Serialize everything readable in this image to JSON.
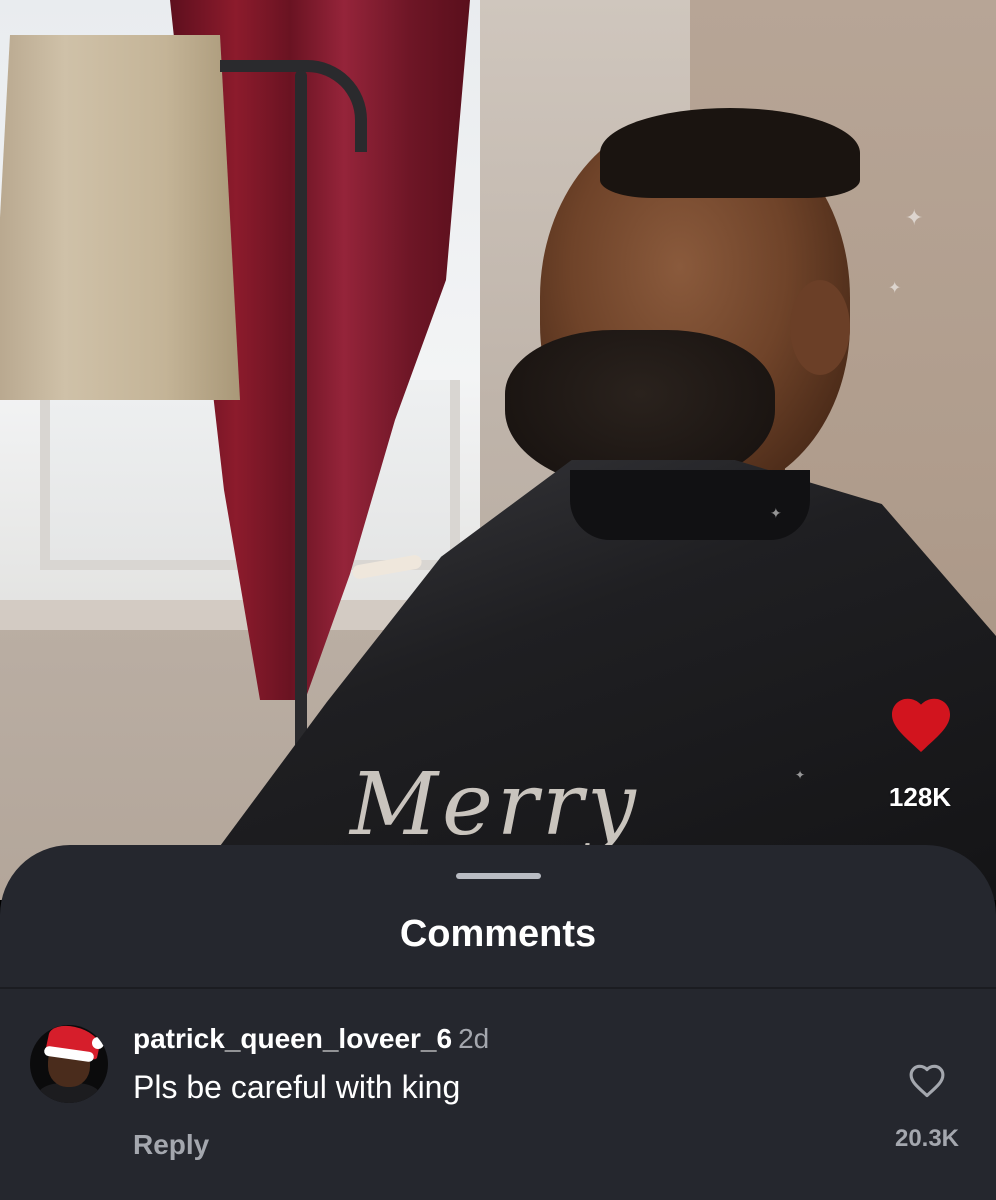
{
  "video": {
    "like_icon": "heart-filled-icon",
    "like_count": "128K",
    "like_color": "#d2141e",
    "cape_text": "Merry"
  },
  "comments_sheet": {
    "title": "Comments",
    "background": "#25272e",
    "comments": [
      {
        "username": "patrick_queen_loveer_6",
        "time": "2d",
        "text": "Pls be careful with king",
        "reply_label": "Reply",
        "like_icon": "heart-outline-icon",
        "like_count": "20.3K"
      }
    ]
  }
}
